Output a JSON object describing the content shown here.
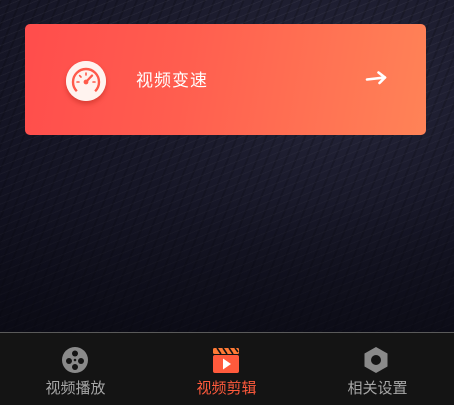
{
  "card": {
    "label": "视频变速",
    "icon": "speedometer-icon",
    "arrow_icon": "arrow-right-icon",
    "gradient_start": "#ff4d4c",
    "gradient_end": "#ff8357"
  },
  "tabs": [
    {
      "label": "视频播放",
      "icon": "film-reel-icon",
      "active": false
    },
    {
      "label": "视频剪辑",
      "icon": "clapperboard-play-icon",
      "active": true
    },
    {
      "label": "相关设置",
      "icon": "hex-nut-icon",
      "active": false
    }
  ],
  "colors": {
    "active_tab": "#ff5a3c",
    "inactive_tab": "#a6a6a6",
    "tabbar_bg": "#141414"
  }
}
